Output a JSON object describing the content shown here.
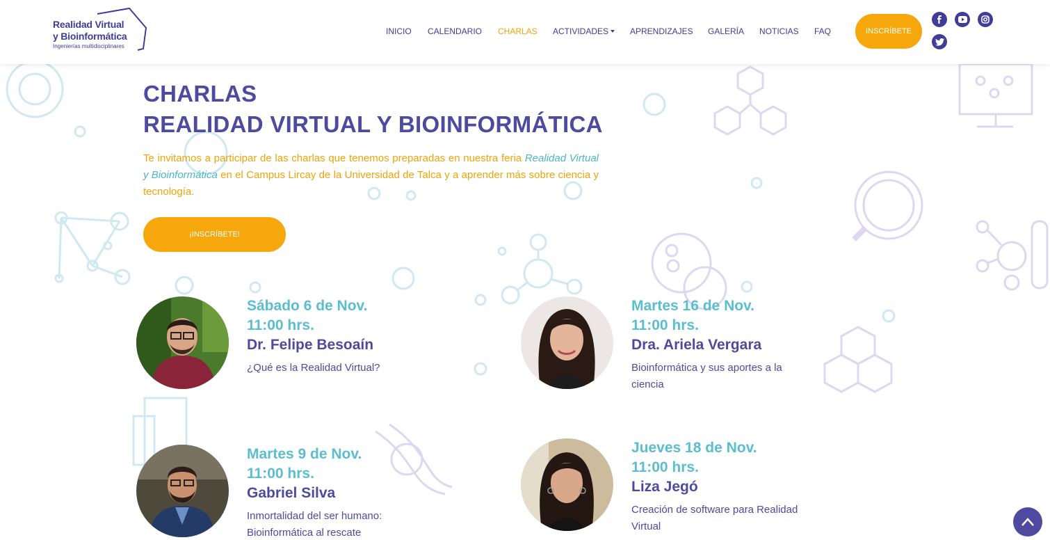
{
  "brand": {
    "line1": "Realidad Virtual",
    "line2": "y Bioinformática",
    "line3": "Ingenierías multidisciplinares"
  },
  "nav": {
    "items": [
      {
        "label": "INICIO"
      },
      {
        "label": "CALENDARIO"
      },
      {
        "label": "CHARLAS"
      },
      {
        "label": "ACTIVIDADES"
      },
      {
        "label": "APRENDIZAJES"
      },
      {
        "label": "GALERÍA"
      },
      {
        "label": "NOTICIAS"
      },
      {
        "label": "FAQ"
      }
    ],
    "active": "CHARLAS",
    "cta": "INSCRÍBETE"
  },
  "social": [
    "facebook-icon",
    "youtube-icon",
    "instagram-icon",
    "twitter-icon"
  ],
  "colors": {
    "primary": "#4d4aa0",
    "accent": "#f5a70b",
    "teal": "#5bbdd0"
  },
  "hero": {
    "title_line1": "CHARLAS",
    "title_line2": "REALIDAD VIRTUAL Y BIOINFORMÁTICA",
    "intro_before": "Te invitamos a participar de las charlas que tenemos preparadas en nuestra feria ",
    "intro_em": "Realidad Virtual y Bioinformática",
    "intro_after": " en el Campus Lircay de la Universidad de Talca y a aprender más sobre ciencia y tecnología.",
    "cta": "¡INSCRÍBETE!"
  },
  "talks": [
    {
      "date": "Sábado 6 de Nov.",
      "time": "11:00 hrs.",
      "speaker": "Dr. Felipe Besoaín",
      "title": "¿Qué es la Realidad Virtual?"
    },
    {
      "date": "Martes 16 de Nov.",
      "time": "11:00 hrs.",
      "speaker": "Dra. Ariela Vergara",
      "title": "Bioinformática y sus aportes a la ciencia"
    },
    {
      "date": "Martes 9 de Nov.",
      "time": "11:00 hrs.",
      "speaker": "Gabriel Silva",
      "title": "Inmortalidad del ser humano: Bioinformática al rescate"
    },
    {
      "date": "Jueves 18 de Nov.",
      "time": "11:00 hrs.",
      "speaker": "Liza Jegó",
      "title": "Creación de software para Realidad Virtual"
    }
  ]
}
